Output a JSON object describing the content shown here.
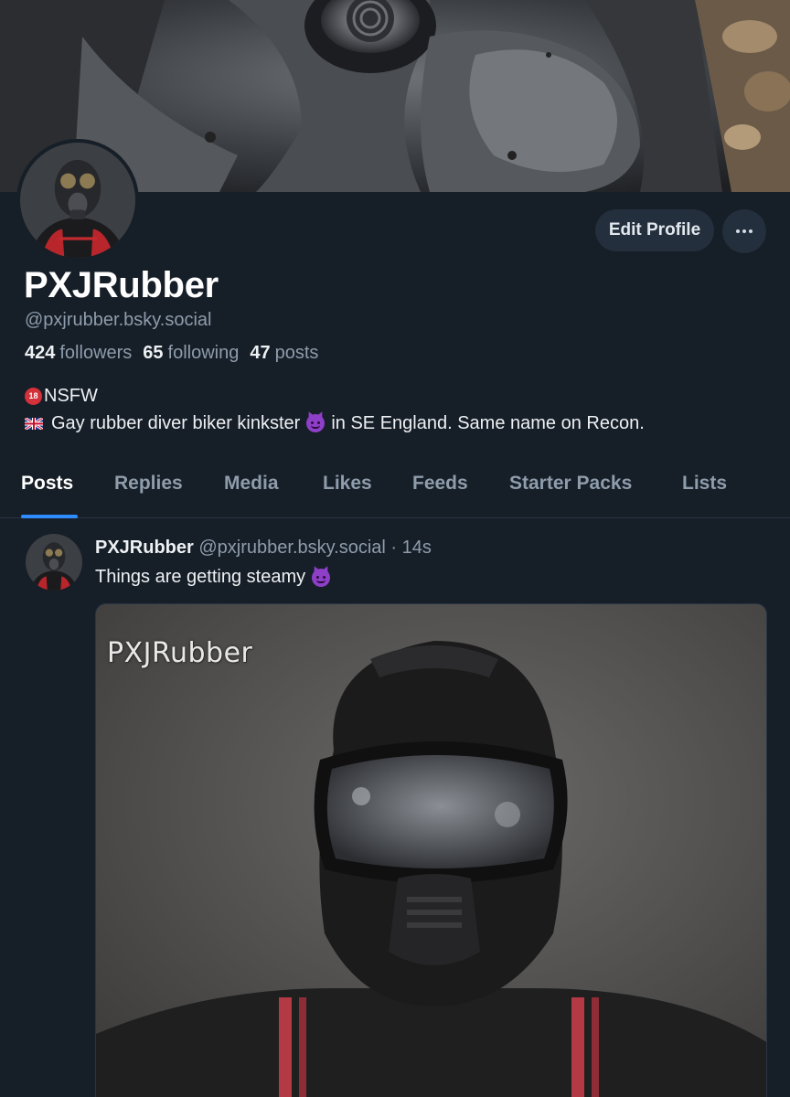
{
  "profile": {
    "display_name": "PXJRubber",
    "handle": "@pxjrubber.bsky.social",
    "stats": {
      "followers_count": "424",
      "followers_label": "followers",
      "following_count": "65",
      "following_label": "following",
      "posts_count": "47",
      "posts_label": "posts"
    },
    "bio": {
      "line1": "NSFW",
      "line2_a": "Gay rubber diver biker kinkster",
      "line2_b": "in SE England. Same name on Recon."
    },
    "edit_button_label": "Edit Profile",
    "nsfw_badge_text": "18"
  },
  "tabs": [
    {
      "label": "Posts",
      "active": true
    },
    {
      "label": "Replies",
      "active": false
    },
    {
      "label": "Media",
      "active": false
    },
    {
      "label": "Likes",
      "active": false
    },
    {
      "label": "Feeds",
      "active": false
    },
    {
      "label": "Starter Packs",
      "active": false
    },
    {
      "label": "Lists",
      "active": false
    }
  ],
  "post": {
    "author_name": "PXJRubber",
    "author_handle": "@pxjrubber.bsky.social",
    "time": "· 14s",
    "text": "Things are getting steamy",
    "image_watermark": "PXJRubber"
  },
  "colors": {
    "background": "#161e27",
    "accent": "#2f8cff",
    "muted_text": "#8e9cac",
    "button_bg": "#232f3d"
  },
  "icons": [
    "more-options-icon",
    "no-under-18-icon",
    "uk-flag-icon",
    "smiling-devil-emoji-icon"
  ]
}
